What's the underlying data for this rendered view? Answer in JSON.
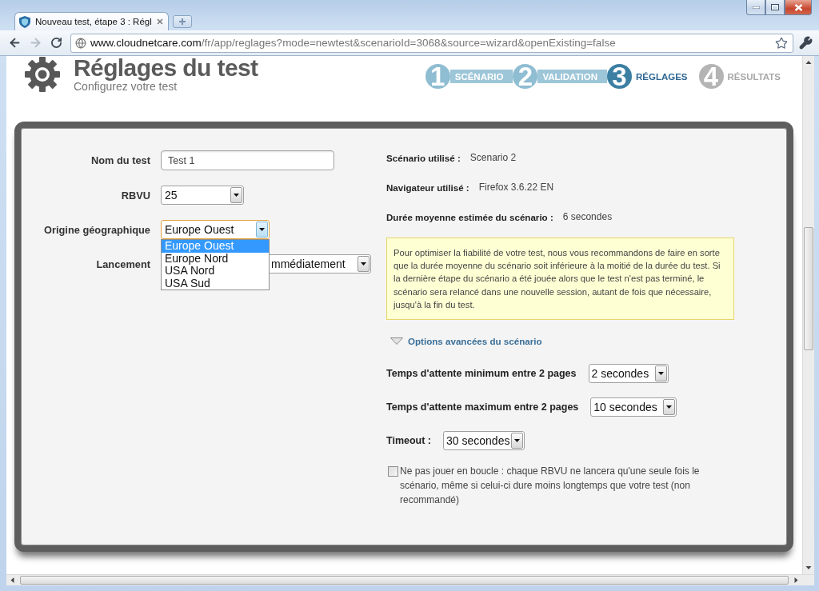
{
  "window": {
    "tabs": [
      {
        "title": "Nouveau test, étape 3 : Régl",
        "selected": true
      }
    ],
    "nav_buttons": [
      {
        "kind": "back",
        "disabled": false
      },
      {
        "kind": "forward",
        "disabled": true
      },
      {
        "kind": "reload",
        "disabled": false
      }
    ],
    "address": {
      "host": "www.cloudnetcare.com",
      "path": "/fr/app/reglages?mode=newtest&scenarioId=3068&source=wizard&openExisting=false"
    }
  },
  "header": {
    "title": "Réglages du test",
    "subtitle": "Configurez votre test"
  },
  "steps": [
    {
      "number": "1",
      "label": "SCÉNARIO",
      "completed": true,
      "selected": false
    },
    {
      "number": "2",
      "label": "VALIDATION",
      "completed": true,
      "selected": false
    },
    {
      "number": "3",
      "label": "RÉGLAGES",
      "completed": false,
      "selected": true
    },
    {
      "number": "4",
      "label": "RÉSULTATS",
      "completed": false,
      "selected": false
    }
  ],
  "form": {
    "fields": [
      {
        "kind": "text",
        "label": "Nom du test",
        "value": "Test 1"
      },
      {
        "kind": "select",
        "label": "RBVU",
        "value": "25"
      },
      {
        "kind": "select",
        "label": "Origine géographique",
        "value": "Europe Ouest",
        "expanded": true,
        "options": [
          {
            "label": "Europe Ouest",
            "selected": true
          },
          {
            "label": "Europe Nord",
            "selected": false
          },
          {
            "label": "USA Nord",
            "selected": false
          },
          {
            "label": "USA Sud",
            "selected": false
          }
        ]
      },
      {
        "kind": "select",
        "label": "Lancement",
        "value": "mmédiatement"
      }
    ]
  },
  "summary": [
    {
      "label": "Scénario utilisé :",
      "value": "Scenario 2"
    },
    {
      "label": "Navigateur utilisé :",
      "value": "Firefox 3.6.22 EN"
    },
    {
      "label": "Durée moyenne estimée du scénario :",
      "value": "6 secondes"
    }
  ],
  "notice": "Pour optimiser la fiabilité de votre test, nous vous recommandons de faire en sorte que la durée moyenne du scénario soit inférieure à la moitié de la durée du test. Si la dernière étape du scénario a été jouée alors que le test n'est pas terminé, le scénario sera relancé dans une nouvelle session, autant de fois que nécessaire, jusqu'à la fin du test.",
  "advanced": {
    "toggle": {
      "label": "Options avancées du scénario",
      "expanded": true
    },
    "fields": [
      {
        "label": "Temps d'attente minimum entre 2 pages",
        "value": "2 secondes"
      },
      {
        "label": "Temps d'attente maximum entre 2 pages",
        "value": "10 secondes"
      },
      {
        "label": "Timeout :",
        "value": "30 secondes"
      }
    ],
    "loop_option": {
      "checked": false,
      "text": "Ne pas jouer en boucle : chaque RBVU ne lancera qu'une seule fois le scénario, même si celui-ci dure moins longtemps que votre test (non recommandé)"
    }
  }
}
